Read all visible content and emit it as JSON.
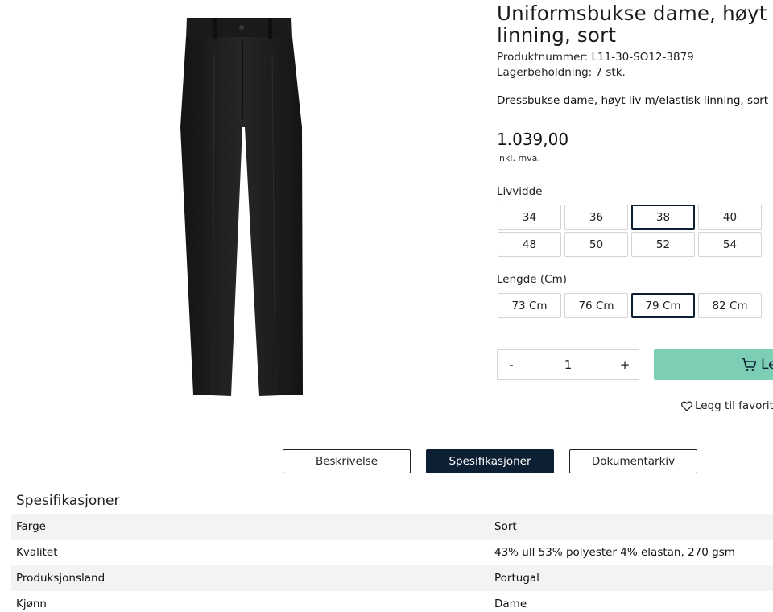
{
  "product": {
    "title_line1": "Uniformsbukse dame, høyt liv",
    "title_line2": "linning, sort",
    "product_number": "Produktnummer: L11-30-SO12-3879",
    "stock": "Lagerbeholdning: 7 stk.",
    "short_description": "Dressbukse dame, høyt liv m/elastisk linning, sort",
    "price": "1.039,00",
    "vat_note": "inkl. mva.",
    "image_icon": "trousers-image",
    "image_color": "#1c1c1c"
  },
  "waist": {
    "label": "Livvidde",
    "options": [
      "34",
      "36",
      "38",
      "40",
      "48",
      "50",
      "52",
      "54"
    ],
    "selected": "38"
  },
  "length": {
    "label": "Lengde (Cm)",
    "options": [
      "73 Cm",
      "76 Cm",
      "79 Cm",
      "82 Cm"
    ],
    "selected": "79 Cm"
  },
  "quantity": {
    "minus": "-",
    "value": "1",
    "plus": "+"
  },
  "cart": {
    "label": "Le",
    "icon": "cart-icon",
    "color": "#7ccfb5"
  },
  "favorite": {
    "label": "Legg til favoritt",
    "icon": "heart-icon"
  },
  "tabs": [
    {
      "label": "Beskrivelse",
      "active": false
    },
    {
      "label": "Spesifikasjoner",
      "active": true
    },
    {
      "label": "Dokumentarkiv",
      "active": false
    }
  ],
  "specs": {
    "heading": "Spesifikasjoner",
    "rows": [
      {
        "key": "Farge",
        "value": "Sort"
      },
      {
        "key": "Kvalitet",
        "value": "43% ull 53% polyester 4% elastan, 270 gsm"
      },
      {
        "key": "Produksjonsland",
        "value": "Portugal"
      },
      {
        "key": "Kjønn",
        "value": "Dame"
      }
    ]
  },
  "colors": {
    "accent_dark": "#0d1f33",
    "border": "#d4d4d4",
    "row_stripe": "#f3f3f3"
  }
}
